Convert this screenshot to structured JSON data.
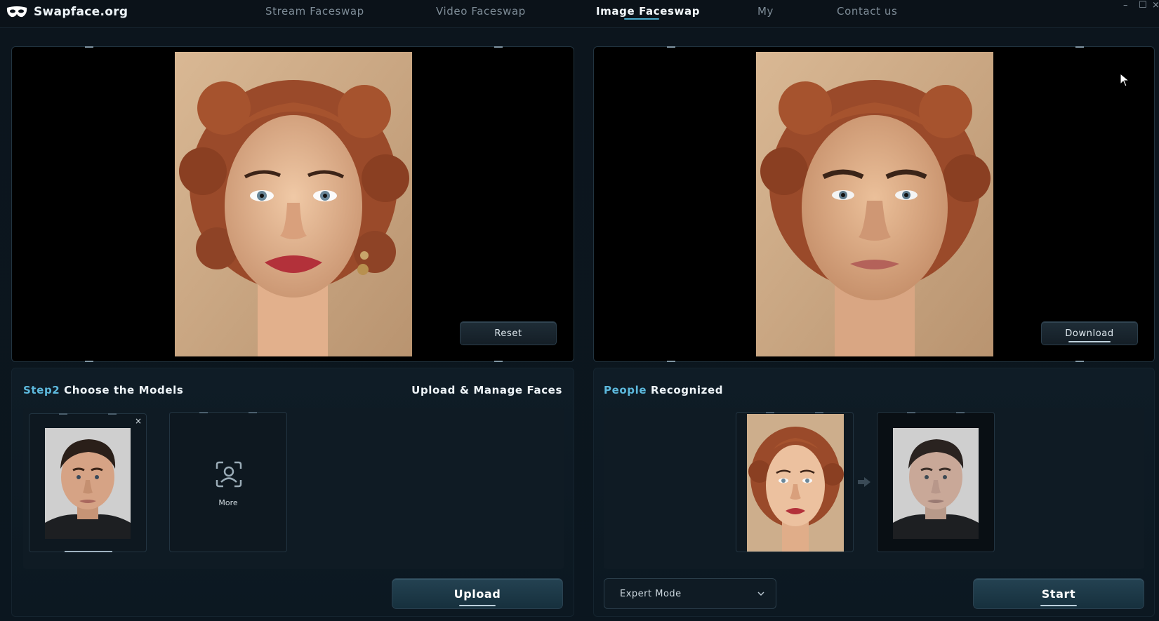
{
  "app": {
    "brand": "Swapface.org",
    "nav": [
      "Stream Faceswap",
      "Video Faceswap",
      "Image Faceswap",
      "My",
      "Contact us"
    ],
    "active_nav": "Image Faceswap",
    "window_controls": [
      "–",
      "☐",
      "×"
    ]
  },
  "source_panel": {
    "reset_label": "Reset"
  },
  "result_panel": {
    "download_label": "Download"
  },
  "models_section": {
    "step_prefix": "Step2",
    "title_rest": " Choose the Models",
    "manage_label": "Upload & Manage Faces",
    "close_label": "×",
    "more_label": "More",
    "upload_label": "Upload"
  },
  "people_section": {
    "title_highlight": "People",
    "title_rest": " Recognized",
    "mode_value": "Expert Mode",
    "start_label": "Start"
  },
  "colors": {
    "accent": "#5db9dd",
    "hair": "#9a4a2a",
    "skin": "#e2b08c",
    "background": "#0b141c"
  },
  "icons": [
    "mask-icon",
    "face-scan-icon",
    "arrow-right-icon",
    "chevron-down-icon",
    "cursor-icon"
  ]
}
